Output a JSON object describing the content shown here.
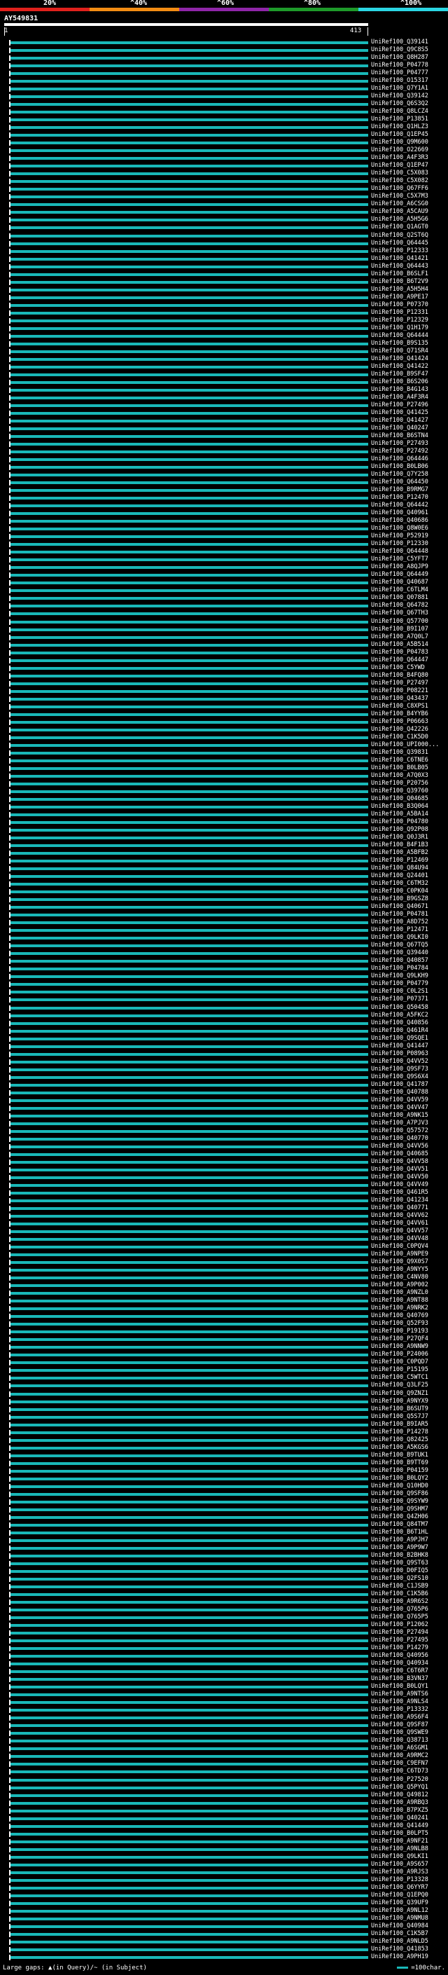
{
  "scale": {
    "labels": [
      "20%",
      "^40%",
      "^60%",
      "^80%",
      "^100%"
    ],
    "colors": [
      "#e0211c",
      "#f28c13",
      "#8f26a8",
      "#1e9a2a",
      "#2bd6e3"
    ]
  },
  "query": {
    "title": "AY549831",
    "start": "1",
    "end": "413"
  },
  "hit_color": "#19b8b8",
  "hits": [
    "UniRef100_Q39141",
    "UniRef100_Q9C8S5",
    "UniRef100_Q8H287",
    "UniRef100_P04778",
    "UniRef100_P04777",
    "UniRef100_O15317",
    "UniRef100_Q7Y1A1",
    "UniRef100_Q39142",
    "UniRef100_Q6S3Q2",
    "UniRef100_Q8LCZ4",
    "UniRef100_P13851",
    "UniRef100_Q1HLZ3",
    "UniRef100_Q1EP45",
    "UniRef100_Q9M600",
    "UniRef100_O22669",
    "UniRef100_A4F3R3",
    "UniRef100_Q1EP47",
    "UniRef100_C5X083",
    "UniRef100_C5X082",
    "UniRef100_Q67FF6",
    "UniRef100_C5X7M3",
    "UniRef100_A6CSG0",
    "UniRef100_A5CAU9",
    "UniRef100_A5H5G6",
    "UniRef100_Q1AGT0",
    "UniRef100_Q2ST6Q",
    "UniRef100_Q64445",
    "UniRef100_P12333",
    "UniRef100_Q41421",
    "UniRef100_Q64443",
    "UniRef100_B6SLF1",
    "UniRef100_B6T2V9",
    "UniRef100_A5H5H4",
    "UniRef100_A9PE17",
    "UniRef100_P07370",
    "UniRef100_P12331",
    "UniRef100_P12329",
    "UniRef100_Q1H179",
    "UniRef100_Q64444",
    "UniRef100_B9S135",
    "UniRef100_Q71SR4",
    "UniRef100_Q41424",
    "UniRef100_Q41422",
    "UniRef100_B9SF47",
    "UniRef100_B6S206",
    "UniRef100_B4G143",
    "UniRef100_A4F3R4",
    "UniRef100_P27496",
    "UniRef100_Q41425",
    "UniRef100_Q41427",
    "UniRef100_Q40247",
    "UniRef100_B6STN4",
    "UniRef100_P27493",
    "UniRef100_P27492",
    "UniRef100_Q64446",
    "UniRef100_B0LB06",
    "UniRef100_Q7Y258",
    "UniRef100_Q64450",
    "UniRef100_B9RMG7",
    "UniRef100_P12470",
    "UniRef100_Q64442",
    "UniRef100_Q40961",
    "UniRef100_Q40686",
    "UniRef100_Q8W0E6",
    "UniRef100_P52919",
    "UniRef100_P12330",
    "UniRef100_Q64448",
    "UniRef100_C5YFT7",
    "UniRef100_A8QJP9",
    "UniRef100_Q64449",
    "UniRef100_Q40687",
    "UniRef100_C6TLM4",
    "UniRef100_Q07881",
    "UniRef100_Q64782",
    "UniRef100_Q67TH3",
    "UniRef100_Q57700",
    "UniRef100_B9I107",
    "UniRef100_A7Q0L7",
    "UniRef100_A5B514",
    "UniRef100_P04783",
    "UniRef100_Q64447",
    "UniRef100_C5YWD",
    "UniRef100_B4FQ80",
    "UniRef100_P27497",
    "UniRef100_P08221",
    "UniRef100_Q43437",
    "UniRef100_C8XPS1",
    "UniRef100_B4YYB6",
    "UniRef100_P06663",
    "UniRef100_Q42226",
    "UniRef100_C1K5D0",
    "UniRef100_UPI000...",
    "UniRef100_Q39831",
    "UniRef100_C6TNE6",
    "UniRef100_B0LB05",
    "UniRef100_A7Q0X3",
    "UniRef100_P20756",
    "UniRef100_Q39760",
    "UniRef100_Q04685",
    "UniRef100_B3Q064",
    "UniRef100_A5BA14",
    "UniRef100_P04780",
    "UniRef100_Q92P08",
    "UniRef100_Q0J3R1",
    "UniRef100_B4F1B3",
    "UniRef100_A5BFB2",
    "UniRef100_P12469",
    "UniRef100_Q84U94",
    "UniRef100_Q24401",
    "UniRef100_C6TM32",
    "UniRef100_C0PK04",
    "UniRef100_B9GSZ8",
    "UniRef100_Q40671",
    "UniRef100_P04781",
    "UniRef100_A8D752",
    "UniRef100_P12471",
    "UniRef100_Q9LKI0",
    "UniRef100_Q67TQ5",
    "UniRef100_Q39440",
    "UniRef100_Q40857",
    "UniRef100_P04784",
    "UniRef100_Q9LKH9",
    "UniRef100_P04779",
    "UniRef100_C0L2S1",
    "UniRef100_P07371",
    "UniRef100_Q50458",
    "UniRef100_A5FKC2",
    "UniRef100_Q40856",
    "UniRef100_Q461R4",
    "UniRef100_Q9SQE1",
    "UniRef100_Q41447",
    "UniRef100_P08963",
    "UniRef100_Q4VV52",
    "UniRef100_Q9SF73",
    "UniRef100_Q9S6X4",
    "UniRef100_Q41787",
    "UniRef100_Q40788",
    "UniRef100_Q4VV59",
    "UniRef100_Q4VV47",
    "UniRef100_A9NK15",
    "UniRef100_A7PJV3",
    "UniRef100_Q57572",
    "UniRef100_Q40770",
    "UniRef100_Q4VV56",
    "UniRef100_Q40685",
    "UniRef100_Q4VV58",
    "UniRef100_Q4VV51",
    "UniRef100_Q4VV50",
    "UniRef100_Q4VV49",
    "UniRef100_Q461R5",
    "UniRef100_Q41234",
    "UniRef100_Q40771",
    "UniRef100_Q4VV62",
    "UniRef100_Q4VV61",
    "UniRef100_Q4VV57",
    "UniRef100_Q4VV48",
    "UniRef100_C0PQV4",
    "UniRef100_A9NPE9",
    "UniRef100_Q9X0S7",
    "UniRef100_A9NYY5",
    "UniRef100_C4NV80",
    "UniRef100_A9P002",
    "UniRef100_A9NZL0",
    "UniRef100_A9NT88",
    "UniRef100_A9NRK2",
    "UniRef100_Q40769",
    "UniRef100_Q52F93",
    "UniRef100_P19193",
    "UniRef100_P27QF4",
    "UniRef100_A9NNW9",
    "UniRef100_P24006",
    "UniRef100_C0PQD7",
    "UniRef100_P15195",
    "UniRef100_C5WTC1",
    "UniRef100_Q3LF25",
    "UniRef100_Q9ZNZ1",
    "UniRef100_A9NYX9",
    "UniRef100_B6SUT9",
    "UniRef100_Q5S7J7",
    "UniRef100_B9IAR5",
    "UniRef100_P14278",
    "UniRef100_Q82425",
    "UniRef100_A5KGS6",
    "UniRef100_B9TUK1",
    "UniRef100_B9TT69",
    "UniRef100_P04159",
    "UniRef100_B0LQY2",
    "UniRef100_Q10HD0",
    "UniRef100_Q9SF86",
    "UniRef100_Q9SYW9",
    "UniRef100_Q9SHM7",
    "UniRef100_Q4ZH06",
    "UniRef100_Q84TM7",
    "UniRef100_B6T1HL",
    "UniRef100_A9PJH7",
    "UniRef100_A9P9W7",
    "UniRef100_B2BHK8",
    "UniRef100_Q9ST63",
    "UniRef100_D0FIQ5",
    "UniRef100_Q2FS10",
    "UniRef100_C1JSB9",
    "UniRef100_C1K5B6",
    "UniRef100_A9R6S2",
    "UniRef100_Q765P6",
    "UniRef100_Q765P5",
    "UniRef100_P12062",
    "UniRef100_P27494",
    "UniRef100_P27495",
    "UniRef100_P14279",
    "UniRef100_Q40956",
    "UniRef100_Q40934",
    "UniRef100_C6T6R7",
    "UniRef100_B3VN37",
    "UniRef100_B0LQY1",
    "UniRef100_A9NTS6",
    "UniRef100_A9NLS4",
    "UniRef100_P13332",
    "UniRef100_A9S6F4",
    "UniRef100_Q9SF87",
    "UniRef100_Q9SWE9",
    "UniRef100_Q38713",
    "UniRef100_A6SGM1",
    "UniRef100_A9RMC2",
    "UniRef100_C9EFN7",
    "UniRef100_C6TD73",
    "UniRef100_P27520",
    "UniRef100_Q5PYQ1",
    "UniRef100_Q49812",
    "UniRef100_A9RBQ3",
    "UniRef100_B7PXZ5",
    "UniRef100_Q40241",
    "UniRef100_Q41449",
    "UniRef100_B0LPT5",
    "UniRef100_A9NF21",
    "UniRef100_A9NLB8",
    "UniRef100_Q9LKI1",
    "UniRef100_A9S657",
    "UniRef100_A9RJS3",
    "UniRef100_P13328",
    "UniRef100_Q6YYR7",
    "UniRef100_Q1EPQ0",
    "UniRef100_Q39UF9",
    "UniRef100_A9NL12",
    "UniRef100_A9NMU8",
    "UniRef100_Q40984",
    "UniRef100_C1K5B7",
    "UniRef100_A9NLD5",
    "UniRef100_Q41853",
    "UniRef100_A9PH19"
  ],
  "legend": {
    "gaps_text": "Large gaps: ▲(in Query)/~ (in Subject)",
    "scale_text": "=100char."
  }
}
